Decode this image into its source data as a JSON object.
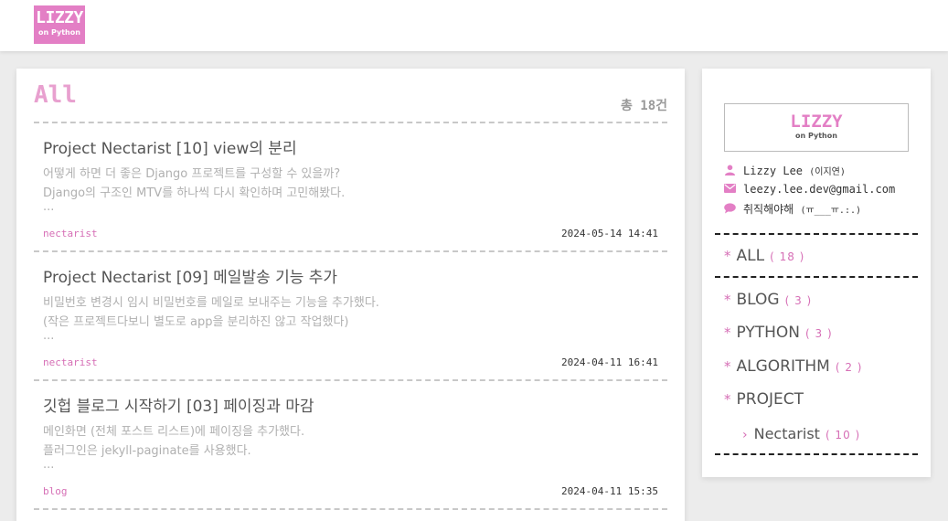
{
  "header": {
    "logo_line1": "LIZZY",
    "logo_line2": "on Python"
  },
  "main": {
    "title": "All",
    "count": "총 18건",
    "posts": [
      {
        "title": "Project Nectarist [10] view의 분리",
        "lines": [
          "어떻게 하면 더 좋은 Django 프로젝트를 구성할 수 있을까?",
          "Django의 구조인 MTV를 하나씩 다시 확인하며 고민해봤다.",
          "..."
        ],
        "tag": "nectarist",
        "date": "2024-05-14 14:41"
      },
      {
        "title": "Project Nectarist [09] 메일발송 기능 추가",
        "lines": [
          "비밀번호 변경시 임시 비밀번호를 메일로 보내주는 기능을 추가했다.",
          "(작은 프로젝트다보니 별도로 app을 분리하진 않고 작업했다)",
          "..."
        ],
        "tag": "nectarist",
        "date": "2024-04-11 16:41"
      },
      {
        "title": "깃헙 블로그 시작하기 [03] 페이징과 마감",
        "lines": [
          "메인화면 (전체 포스트 리스트)에 페이징을 추가했다.",
          "플러그인은 jekyll-paginate를 사용했다.",
          "..."
        ],
        "tag": "blog",
        "date": "2024-04-11 15:35"
      }
    ]
  },
  "sidebar": {
    "logo_line1": "LIZZY",
    "logo_line2": "on Python",
    "name": "Lizzy Lee",
    "name_sub": "(이지연)",
    "email": "leezy.lee.dev@gmail.com",
    "status": "취직해야해",
    "status_sub": "(ㅠ___ㅠ.:.)",
    "icons": {
      "user": "user-icon",
      "mail": "envelope-icon",
      "chat": "chat-bubble-icon"
    },
    "all": {
      "label": "ALL",
      "count": "( 18 )"
    },
    "categories": [
      {
        "label": "BLOG",
        "count": "( 3 )"
      },
      {
        "label": "PYTHON",
        "count": "( 3 )"
      },
      {
        "label": "ALGORITHM",
        "count": "( 2 )"
      },
      {
        "label": "PROJECT",
        "count": ""
      }
    ],
    "subcategory": {
      "label": "Nectarist",
      "count": "( 10 )"
    }
  },
  "colors": {
    "accent": "#e37fc5",
    "accent_text": "#d66fb6",
    "title_pink": "#e8a0cf"
  }
}
